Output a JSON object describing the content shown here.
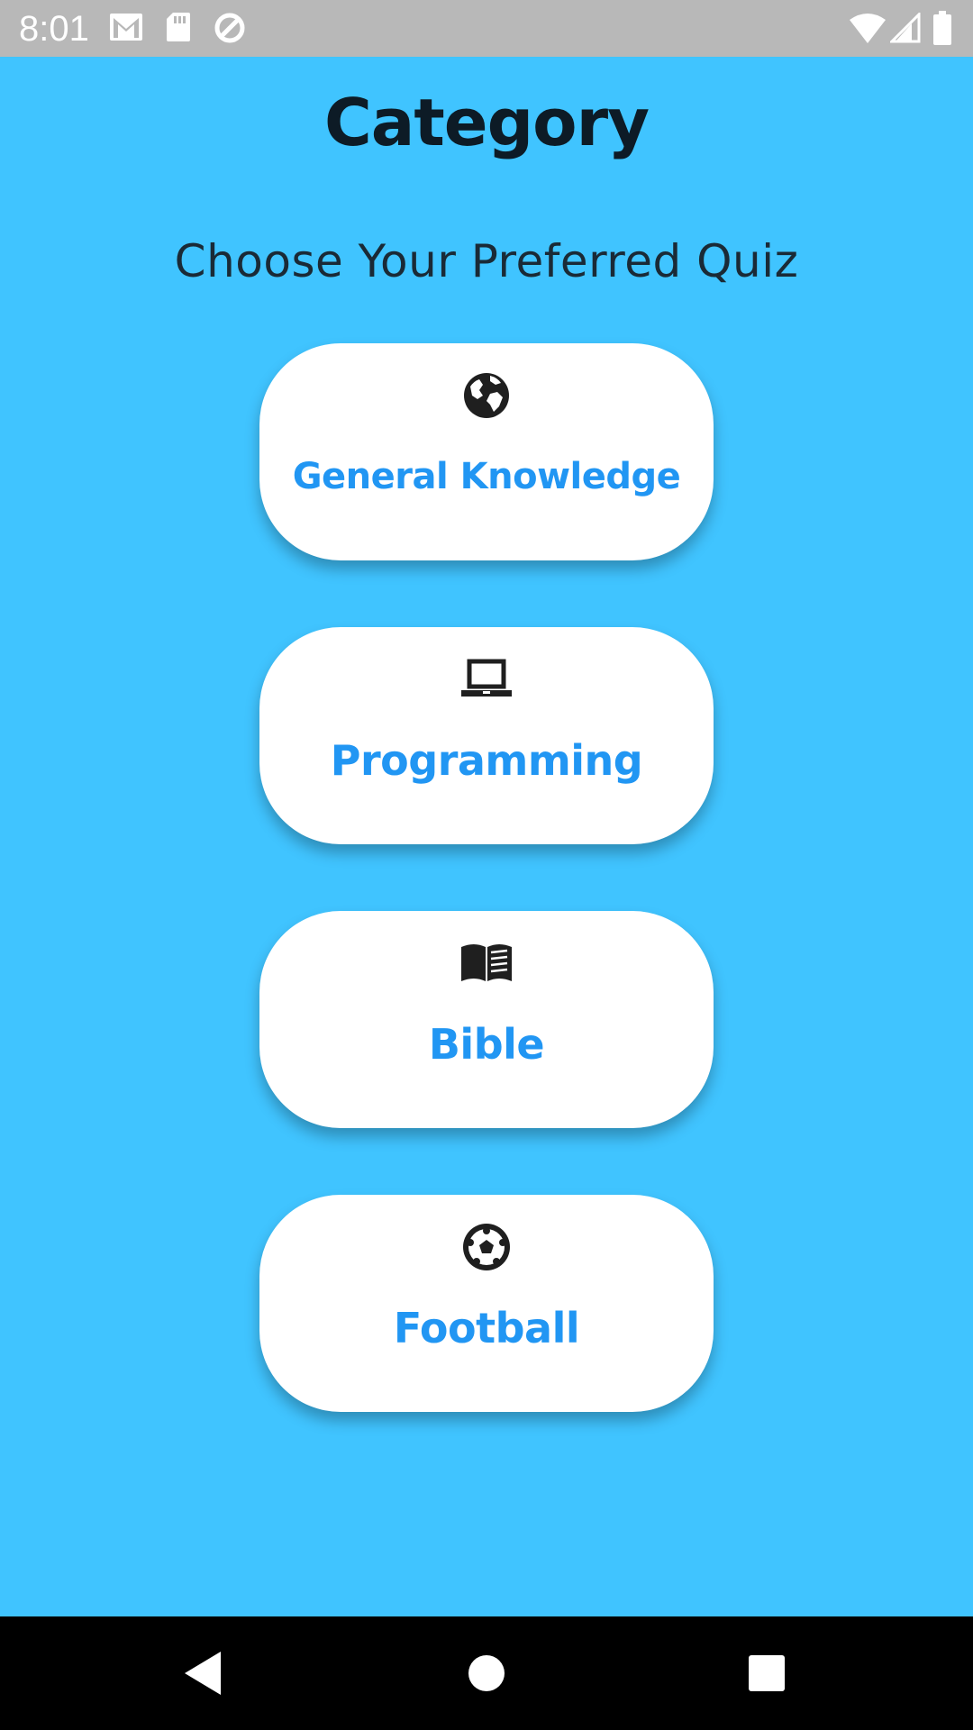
{
  "status_bar": {
    "time": "8:01",
    "icons": [
      "gmail-icon",
      "sd-card-icon",
      "sync-icon",
      "wifi-icon",
      "signal-icon",
      "battery-icon"
    ]
  },
  "header": {
    "title": "Category",
    "subtitle": "Choose Your Preferred Quiz"
  },
  "categories": [
    {
      "label": "General Knowledge",
      "icon": "globe-icon"
    },
    {
      "label": "Programming",
      "icon": "laptop-icon"
    },
    {
      "label": "Bible",
      "icon": "book-icon"
    },
    {
      "label": "Football",
      "icon": "soccer-ball-icon"
    }
  ],
  "nav_bar": {
    "buttons": [
      "back-icon",
      "home-icon",
      "recents-icon"
    ]
  },
  "colors": {
    "background": "#40c4ff",
    "card": "#ffffff",
    "label": "#2196f3",
    "title": "#0d1b26"
  }
}
